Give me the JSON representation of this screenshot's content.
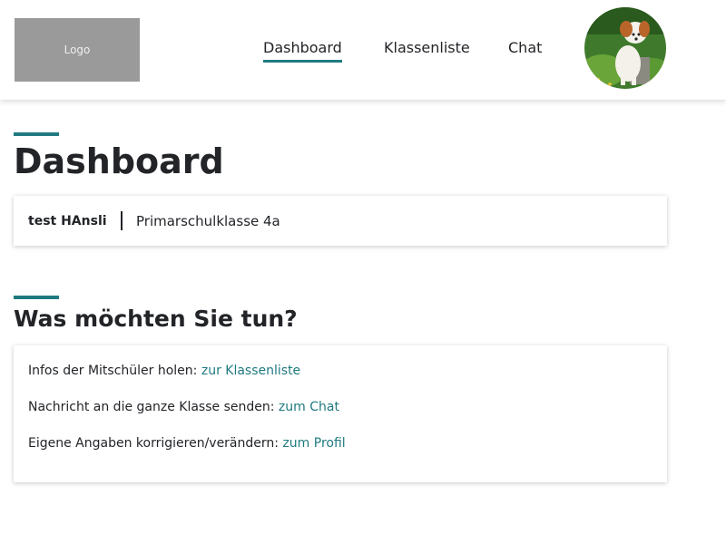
{
  "header": {
    "logo_text": "Logo",
    "nav": {
      "dashboard": "Dashboard",
      "klassenliste": "Klassenliste",
      "chat": "Chat"
    },
    "accent_color": "#1f7a80"
  },
  "page": {
    "title": "Dashboard"
  },
  "user": {
    "name": "test HAnsli",
    "class_name": "Primarschulklasse 4a"
  },
  "actions": {
    "title": "Was möchten Sie tun?",
    "items": [
      {
        "text": "Infos der Mitschüler holen: ",
        "link": "zur Klassenliste"
      },
      {
        "text": "Nachricht an die ganze Klasse senden: ",
        "link": "zum Chat"
      },
      {
        "text": "Eigene Angaben korrigieren/verändern: ",
        "link": "zum Profil"
      }
    ]
  }
}
